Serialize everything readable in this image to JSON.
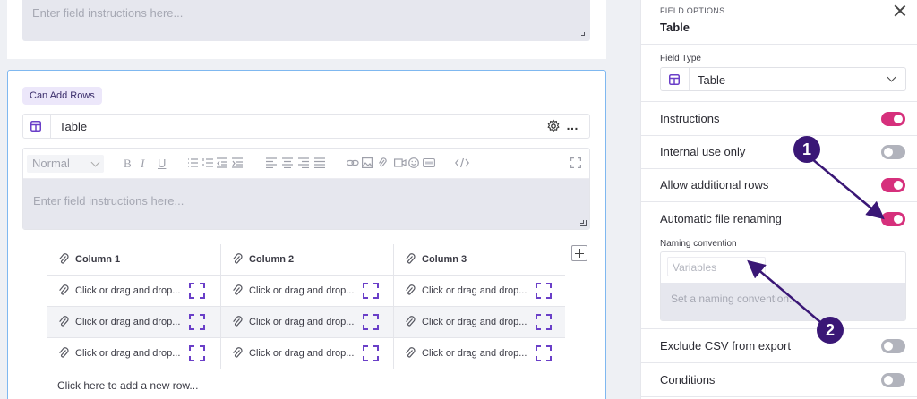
{
  "editor_top": {
    "instructions_placeholder": "Enter field instructions here..."
  },
  "field_card": {
    "badge": "Can Add Rows",
    "field_name": "Table",
    "more_icon": "…",
    "format_select": "Normal",
    "toolbar_glyphs": {
      "bold": "B",
      "italic": "I",
      "underline": "U"
    },
    "instructions_placeholder": "Enter field instructions here...",
    "columns": [
      "Column 1",
      "Column 2",
      "Column 3"
    ],
    "cell_text": "Click or drag and drop...",
    "rows": 3,
    "add_row": "Click here to add a new row..."
  },
  "panel": {
    "section_label": "FIELD OPTIONS",
    "title": "Table",
    "field_type_label": "Field Type",
    "field_type_value": "Table",
    "options": [
      {
        "label": "Instructions",
        "on": true
      },
      {
        "label": "Internal use only",
        "on": false
      },
      {
        "label": "Allow additional rows",
        "on": true
      },
      {
        "label": "Automatic file renaming",
        "on": true
      }
    ],
    "naming_label": "Naming convention",
    "variables_placeholder": "Variables",
    "naming_placeholder": "Set a naming convention...",
    "options_after": [
      {
        "label": "Exclude CSV from export",
        "on": false
      },
      {
        "label": "Conditions",
        "on": false
      }
    ]
  },
  "annotations": {
    "marker_1": "1",
    "marker_2": "2",
    "color": "#3a1776"
  },
  "colors": {
    "accent": "#d6307c",
    "purple_icon": "#6a3fc8",
    "focus_border": "#7fb8f0"
  }
}
